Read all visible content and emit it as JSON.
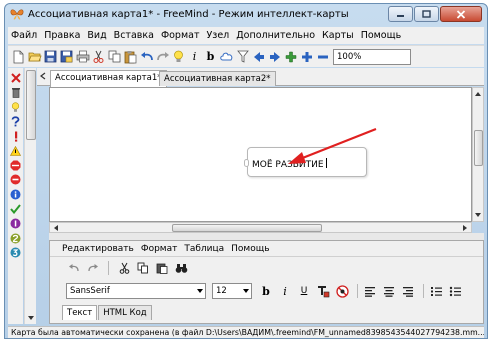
{
  "window": {
    "title": "Ассоциативная карта1* - FreeMind - Режим интеллект-карты"
  },
  "menubar": {
    "items": [
      "Файл",
      "Правка",
      "Вид",
      "Вставка",
      "Формат",
      "Узел",
      "Дополнительно",
      "Карты",
      "Помощь"
    ]
  },
  "toolbar": {
    "bold_glyph": "b",
    "italic_glyph": "i",
    "zoom_value": "100%"
  },
  "tabs": [
    {
      "label": "Ассоциативная карта1*",
      "active": true
    },
    {
      "label": "Ассоциативная карта2*",
      "active": false
    }
  ],
  "map": {
    "root_node_text": "МОЁ РАЗВИТИЕ",
    "arrow_color": "#e02020"
  },
  "editor": {
    "menu_items": [
      "Редактировать",
      "Формат",
      "Таблица",
      "Помощь"
    ],
    "font_name": "SansSerif",
    "font_size": "12",
    "format_glyphs": {
      "bold": "b",
      "italic": "i",
      "underline": "U"
    },
    "bottom_tabs": [
      {
        "label": "Текст",
        "active": true
      },
      {
        "label": "HTML Код",
        "active": false
      }
    ]
  },
  "status": {
    "text": "Карта была автоматически сохранена (в файл D:\\Users\\ВАДИМ\\.freemind\\FM_unnamed8398543544027794238.mm..."
  },
  "icons": {
    "toolbar": [
      "new-map-icon",
      "open-icon",
      "save-icon",
      "save-as-icon",
      "print-icon",
      "cut-icon",
      "copy-icon",
      "paste-icon",
      "undo-icon",
      "redo-icon",
      "idea-icon",
      "italic-icon",
      "bold-icon",
      "cloud-icon",
      "filter-icon",
      "nav-left-icon",
      "nav-right-icon",
      "zoom-in-icon",
      "zoom-out-icon"
    ],
    "left_strip": [
      "remove-icon",
      "trash-icon",
      "bulb-icon",
      "question-icon",
      "exclamation-icon",
      "warning-icon",
      "stop-icon",
      "minus-circle-icon",
      "info-icon",
      "check-icon",
      "priority-1-icon",
      "priority-2-icon",
      "priority-3-icon"
    ]
  }
}
